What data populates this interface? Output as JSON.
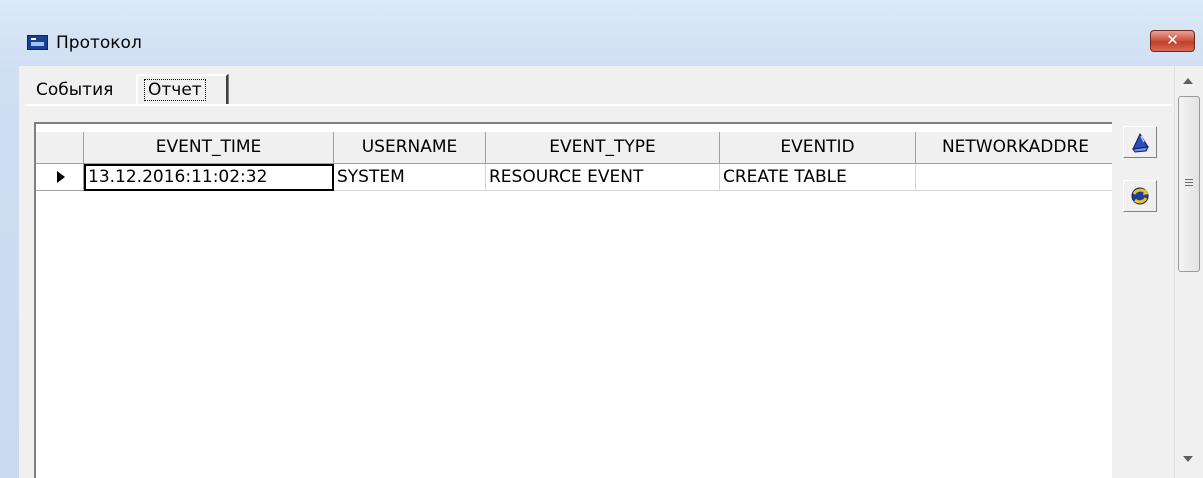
{
  "window": {
    "title": "Протокол",
    "close_label": "✕"
  },
  "tabs": [
    {
      "label": "События",
      "active": false
    },
    {
      "label": "Отчет",
      "active": true
    }
  ],
  "grid": {
    "columns": [
      "EVENT_TIME",
      "USERNAME",
      "EVENT_TYPE",
      "EVENTID",
      "NETWORKADDRE"
    ],
    "rows": [
      [
        "13.12.2016:11:02:32",
        "SYSTEM",
        "RESOURCE EVENT",
        "CREATE TABLE",
        ""
      ]
    ]
  },
  "toolbar": {
    "buttons": [
      {
        "icon": "print-icon"
      },
      {
        "icon": "refresh-icon"
      }
    ]
  },
  "colors": {
    "title_gradient_top": "#dbe8f7",
    "close_red": "#c23d27",
    "face": "#f0f0f0"
  }
}
